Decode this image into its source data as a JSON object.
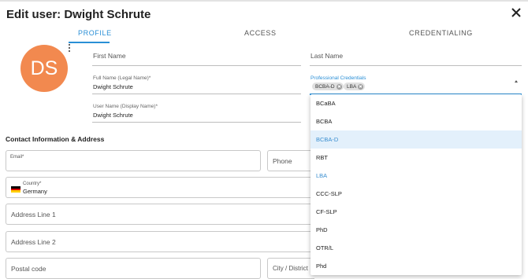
{
  "dialog": {
    "title": "Edit user: Dwight Schrute"
  },
  "tabs": [
    {
      "label": "PROFILE"
    },
    {
      "label": "ACCESS"
    },
    {
      "label": "CREDENTIALING"
    }
  ],
  "avatar": {
    "initials": "DS",
    "color": "#f2894f"
  },
  "profile": {
    "first_name_placeholder": "First Name",
    "last_name_placeholder": "Last Name",
    "full_name_label": "Full Name (Legal Name)*",
    "full_name_value": "Dwight Schrute",
    "user_name_label": "User Name (Display Name)*",
    "user_name_value": "Dwight Schrute",
    "credentials_label": "Professional Credentials",
    "selected_credentials": [
      "BCBA-D",
      "LBA"
    ]
  },
  "contact": {
    "section_title": "Contact Information & Address",
    "email_label": "Email*",
    "phone_placeholder": "Phone",
    "country_label": "Country*",
    "country_value": "Germany",
    "address1_placeholder": "Address Line 1",
    "address2_placeholder": "Address Line 2",
    "postal_placeholder": "Postal code",
    "city_placeholder": "City / District"
  },
  "credential_options": [
    {
      "label": "BCaBA"
    },
    {
      "label": "BCBA"
    },
    {
      "label": "BCBA-D",
      "state": "highlighted-selected"
    },
    {
      "label": "RBT"
    },
    {
      "label": "LBA",
      "state": "selected"
    },
    {
      "label": "CCC-SLP"
    },
    {
      "label": "CF-SLP"
    },
    {
      "label": "PhD"
    },
    {
      "label": "OTR/L"
    },
    {
      "label": "Phd"
    }
  ],
  "colors": {
    "accent": "#2a8fd6",
    "highlight_bg": "#e3f0fb"
  }
}
